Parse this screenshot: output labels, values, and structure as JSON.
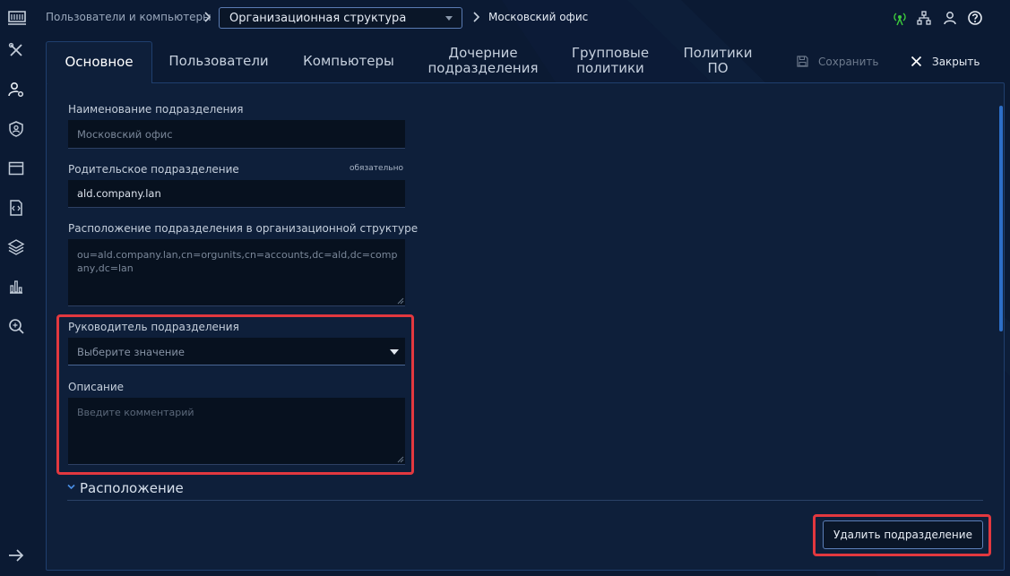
{
  "breadcrumb": {
    "root": "Пользователи и компьютеры",
    "selected": "Организационная структура",
    "current": "Московский офис"
  },
  "header_icons": [
    "signal-icon",
    "network-icon",
    "user-icon",
    "help-icon"
  ],
  "sidebar_icons": [
    "tools-icon",
    "users-settings-icon",
    "shield-user-icon",
    "window-icon",
    "script-icon",
    "layers-icon",
    "chart-icon",
    "search-doc-icon",
    "arrow-right-icon"
  ],
  "tabs": [
    {
      "label": "Основное",
      "active": true
    },
    {
      "label": "Пользователи"
    },
    {
      "label": "Компьютеры"
    },
    {
      "label": "Дочерние подразделения"
    },
    {
      "label": "Групповые политики"
    },
    {
      "label": "Политики ПО"
    }
  ],
  "actions": {
    "save": "Сохранить",
    "close": "Закрыть"
  },
  "form": {
    "name": {
      "label": "Наименование подразделения",
      "value": "Московский офис"
    },
    "parent": {
      "label": "Родительское подразделение",
      "required": "обязательно",
      "value": "ald.company.lan"
    },
    "location": {
      "label": "Расположение подразделения в организационной структуре",
      "value": "ou=ald.company.lan,cn=orgunits,cn=accounts,dc=ald,dc=company,dc=lan"
    },
    "head": {
      "label": "Руководитель подразделения",
      "placeholder": "Выберите значение"
    },
    "description": {
      "label": "Описание",
      "placeholder": "Введите комментарий"
    }
  },
  "section": {
    "title": "Расположение"
  },
  "delete_button": "Удалить подразделение",
  "colors": {
    "background": "#0b1a33",
    "panel": "#0e1f3a",
    "highlight": "#e2383f",
    "accent": "#2d6fc8",
    "signal": "#3cc83c"
  }
}
